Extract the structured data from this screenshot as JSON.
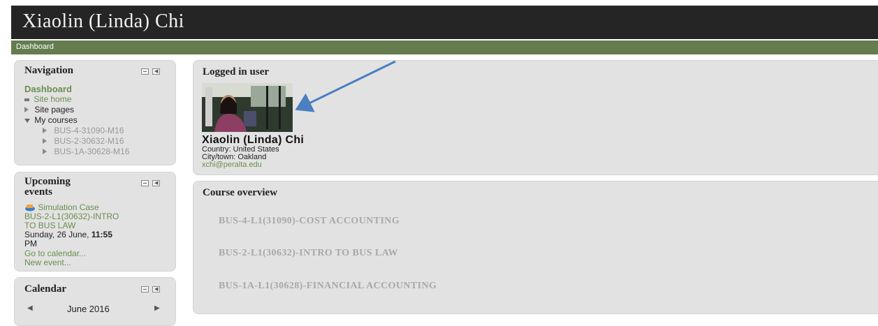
{
  "header": {
    "title": "Xiaolin (Linda) Chi"
  },
  "navbar": {
    "breadcrumb": "Dashboard"
  },
  "navigation": {
    "title": "Navigation",
    "dashboard": "Dashboard",
    "site_home": "Site home",
    "site_pages": "Site pages",
    "my_courses": "My courses",
    "courses": [
      "BUS-4-31090-M16",
      "BUS-2-30632-M16",
      "BUS-1A-30628-M16"
    ]
  },
  "upcoming": {
    "title_line1": "Upcoming",
    "title_line2": "events",
    "event_name": "Simulation Case",
    "event_course_line1": "BUS-2-L1(30632)-INTRO",
    "event_course_line2": "TO BUS LAW",
    "event_date": "Sunday, 26 June,",
    "event_time_bold": "11:55",
    "event_time_suffix": "PM",
    "go_to_calendar": "Go to calendar...",
    "new_event": "New event..."
  },
  "calendar": {
    "title": "Calendar",
    "month": "June 2016"
  },
  "logged_in": {
    "title": "Logged in user",
    "name": "Xiaolin (Linda) Chi",
    "country": "Country: United States",
    "city": "City/town: Oakland",
    "email": "xchi@peralta.edu"
  },
  "course_overview": {
    "title": "Course overview",
    "courses": [
      "BUS-4-L1(31090)-COST ACCOUNTING",
      "BUS-2-L1(30632)-INTRO TO BUS LAW",
      "BUS-1A-L1(30628)-FINANCIAL ACCOUNTING"
    ]
  },
  "colors": {
    "header_bg": "#252525",
    "navbar_bg": "#647c4e",
    "link_green": "#6b8e4e",
    "annotation_arrow": "#4a7fc1"
  }
}
